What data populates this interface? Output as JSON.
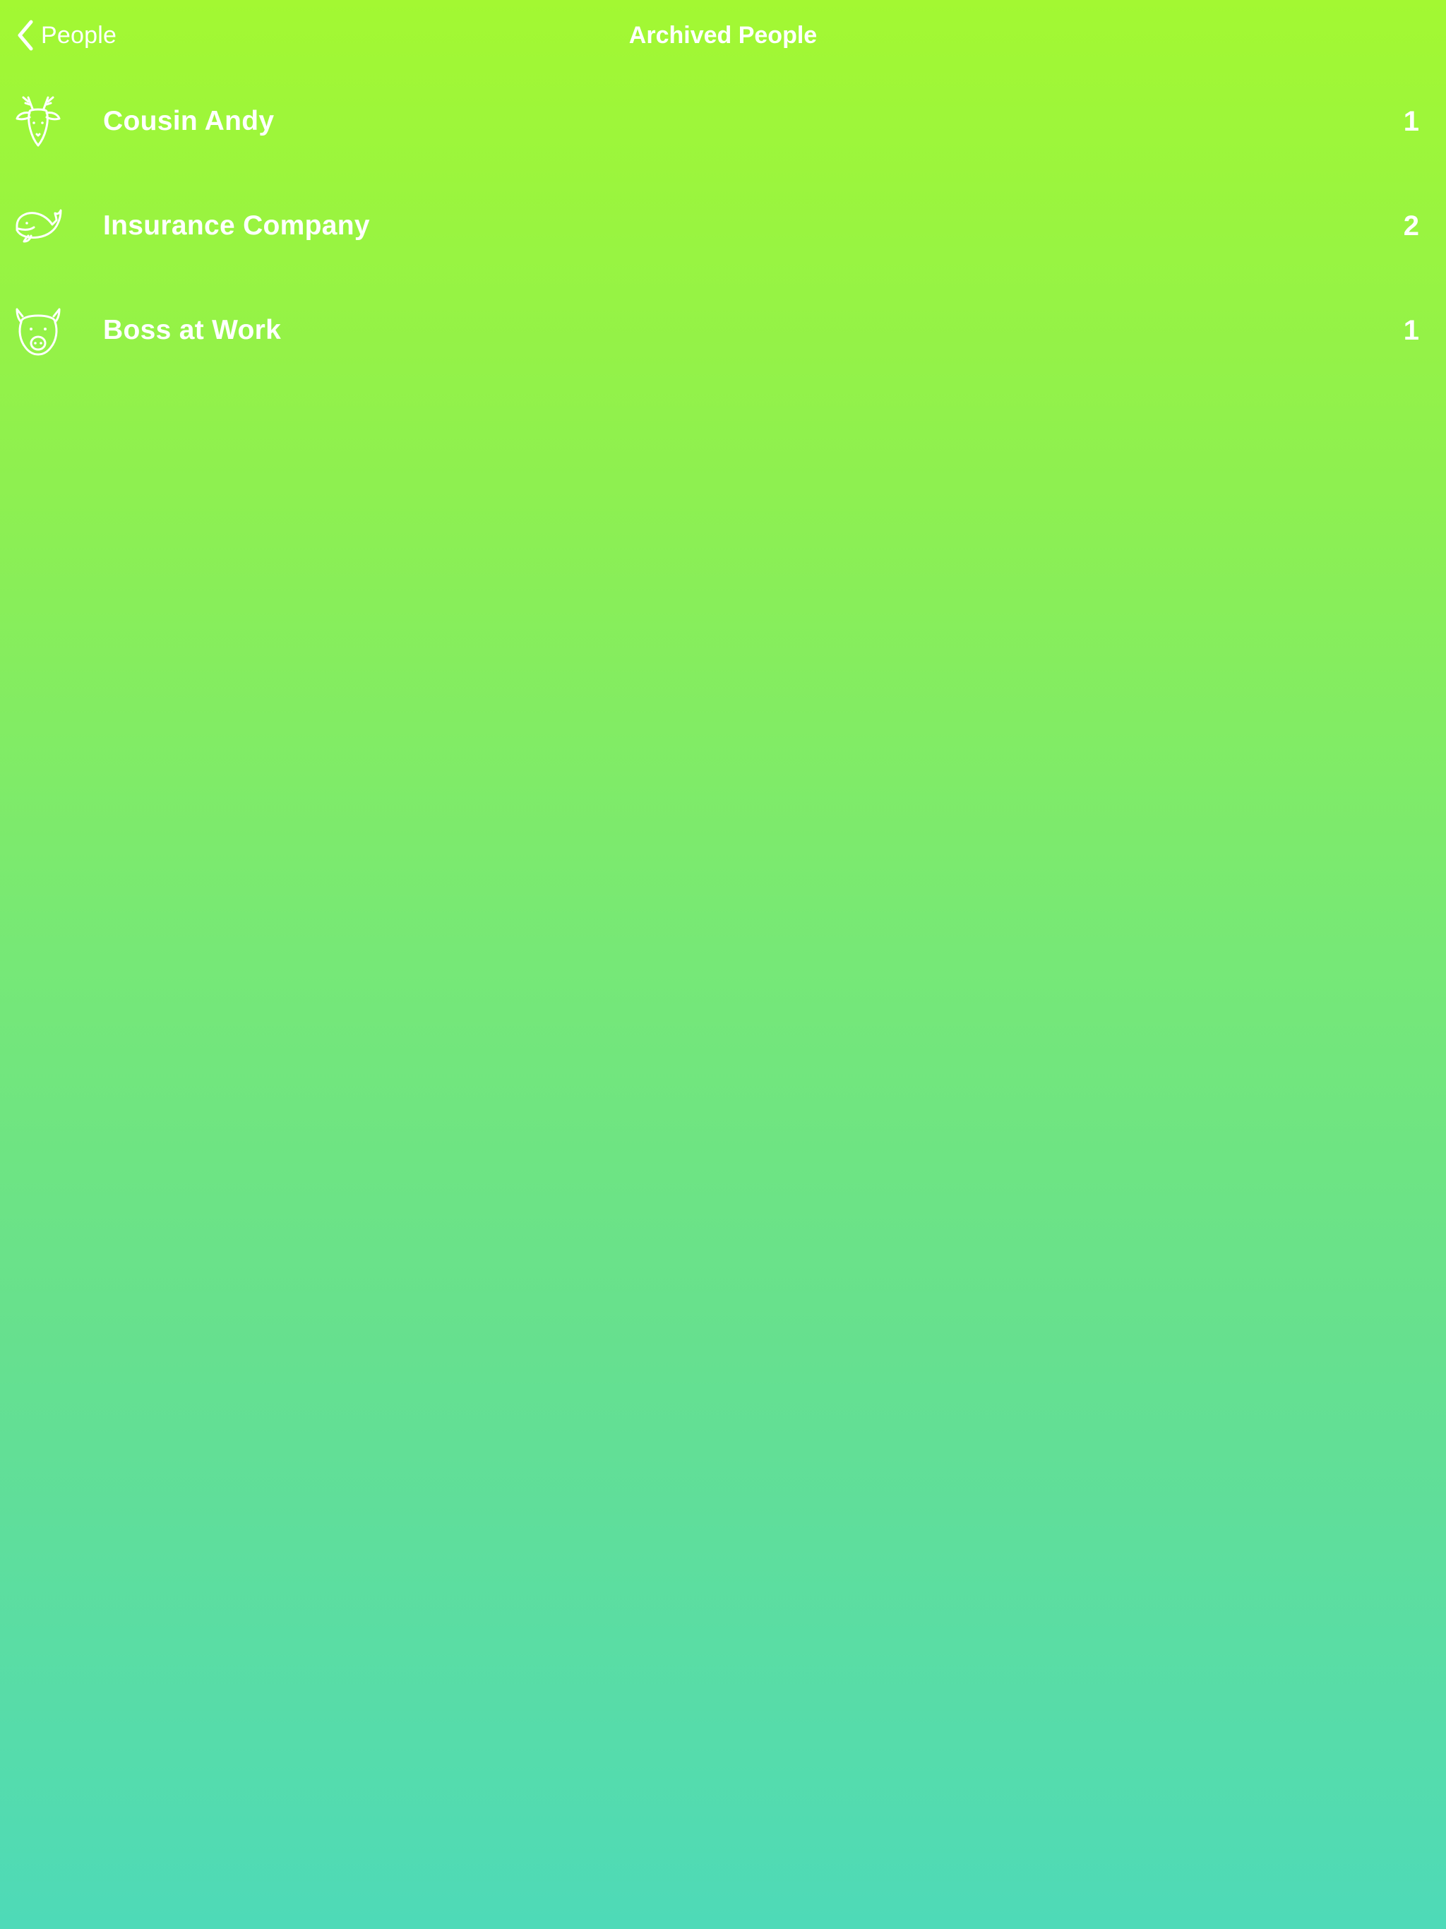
{
  "nav": {
    "back_label": "People",
    "back_icon": "chevron-left-icon",
    "title": "Archived People"
  },
  "people": [
    {
      "name": "Cousin Andy",
      "count": "1",
      "icon": "deer-icon"
    },
    {
      "name": "Insurance Company",
      "count": "2",
      "icon": "whale-icon"
    },
    {
      "name": "Boss at Work",
      "count": "1",
      "icon": "pig-icon"
    }
  ],
  "colors": {
    "gradient_top": "#a3f832",
    "gradient_bottom": "#4edab8",
    "text": "#ffffff"
  }
}
